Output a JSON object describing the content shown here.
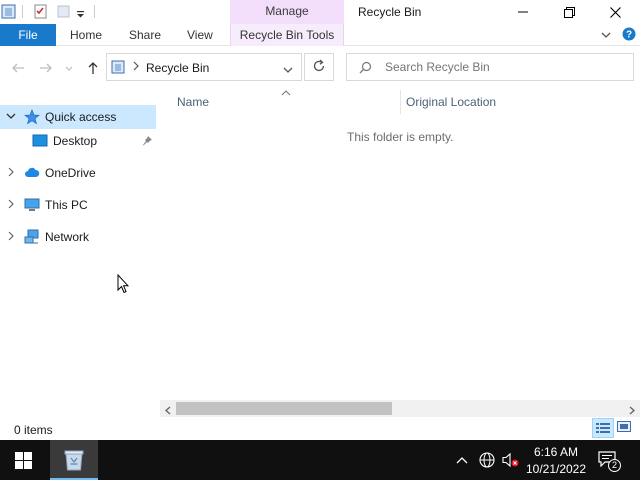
{
  "window": {
    "title": "Recycle Bin",
    "context_group": "Manage"
  },
  "ribbon": {
    "tabs": [
      "File",
      "Home",
      "Share",
      "View",
      "Recycle Bin Tools"
    ]
  },
  "address": {
    "path": "Recycle Bin",
    "search_placeholder": "Search Recycle Bin"
  },
  "navpane": {
    "items": [
      {
        "label": "Quick access",
        "icon": "star-icon",
        "selected": true
      },
      {
        "label": "Desktop",
        "icon": "desktop-icon",
        "pinned": true
      },
      {
        "label": "OneDrive",
        "icon": "cloud-icon"
      },
      {
        "label": "This PC",
        "icon": "computer-icon"
      },
      {
        "label": "Network",
        "icon": "network-icon"
      }
    ]
  },
  "content": {
    "columns": [
      "Name",
      "Original Location"
    ],
    "empty_message": "This folder is empty."
  },
  "status": {
    "item_count": "0 items"
  },
  "taskbar": {
    "time": "6:16 AM",
    "date": "10/21/2022",
    "notification_count": "2"
  },
  "colors": {
    "accent": "#1979ca",
    "context_tab": "#f2ddfa",
    "selection": "#cce8ff",
    "taskbar": "#101010"
  }
}
